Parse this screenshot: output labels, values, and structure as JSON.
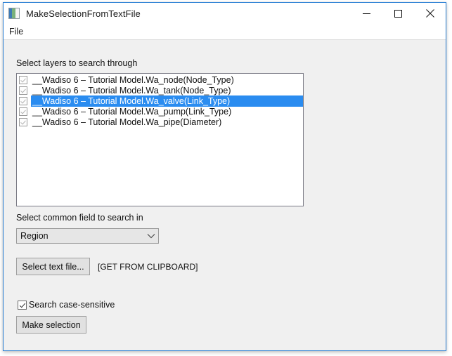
{
  "window": {
    "title": "MakeSelectionFromTextFile",
    "icon": "application-image-icon",
    "border_color": "#2a7fd4",
    "controls": [
      {
        "name": "minimize",
        "glyph": "minimize-icon"
      },
      {
        "name": "maximize",
        "glyph": "maximize-icon"
      },
      {
        "name": "close",
        "glyph": "close-icon"
      }
    ]
  },
  "menu": {
    "items": [
      {
        "label": "File"
      }
    ]
  },
  "form": {
    "layers_label": "Select layers to search through",
    "layers": [
      {
        "text": "__Wadiso 6 – Tutorial Model.Wa_node(Node_Type)",
        "checked": true,
        "selected": false
      },
      {
        "text": "__Wadiso 6 – Tutorial Model.Wa_tank(Node_Type)",
        "checked": true,
        "selected": false
      },
      {
        "text": "__Wadiso 6 – Tutorial Model.Wa_valve(Link_Type)",
        "checked": true,
        "selected": true
      },
      {
        "text": "__Wadiso 6 – Tutorial Model.Wa_pump(Link_Type)",
        "checked": true,
        "selected": false
      },
      {
        "text": "__Wadiso 6 – Tutorial Model.Wa_pipe(Diameter)",
        "checked": true,
        "selected": false
      }
    ],
    "field_label": "Select common field to search in",
    "field_value": "Region",
    "select_text_file_button": "Select text file...",
    "clipboard_hint": "[GET FROM CLIPBOARD]",
    "case_sensitive_label": "Search case-sensitive",
    "case_sensitive_checked": true,
    "make_selection_button": "Make selection"
  },
  "colors": {
    "selection_blue": "#2a8cf0",
    "window_border": "#2a7fd4",
    "form_background": "#f0f0f0",
    "button_face": "#e1e1e1"
  }
}
